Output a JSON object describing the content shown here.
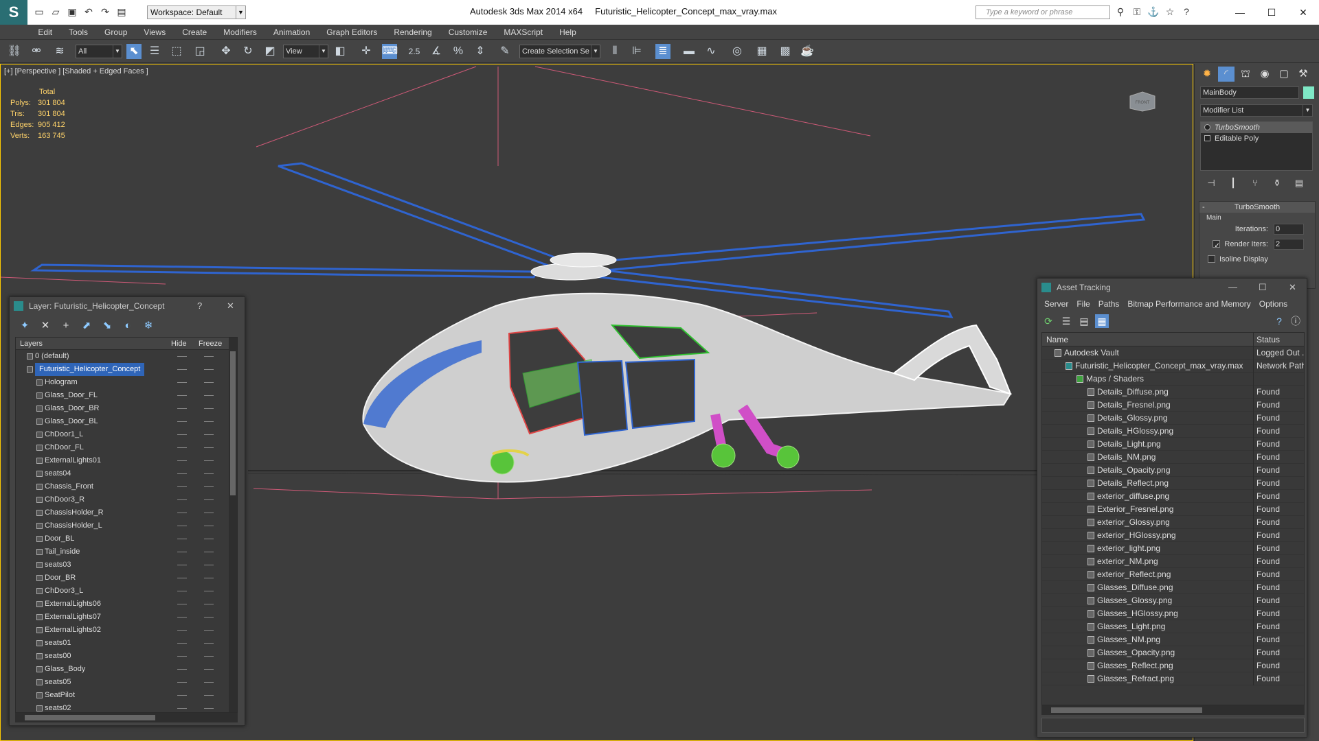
{
  "titlebar": {
    "workspace": "Workspace: Default",
    "app_name": "Autodesk 3ds Max  2014 x64",
    "file_name": "Futuristic_Helicopter_Concept_max_vray.max",
    "search_placeholder": "Type a keyword or phrase",
    "minimize": "—",
    "maximize": "☐",
    "close": "✕"
  },
  "menu": [
    "Edit",
    "Tools",
    "Group",
    "Views",
    "Create",
    "Modifiers",
    "Animation",
    "Graph Editors",
    "Rendering",
    "Customize",
    "MAXScript",
    "Help"
  ],
  "toolbar": {
    "selection_filter": "All",
    "coord_system": "View",
    "snap_label": "2.5",
    "named_selection": "Create Selection Se"
  },
  "viewport": {
    "label": "[+] [Perspective ] [Shaded + Edged Faces ]",
    "stats_header": "Total",
    "stats": [
      {
        "label": "Polys:",
        "value": "301 804"
      },
      {
        "label": "Tris:",
        "value": "301 804"
      },
      {
        "label": "Edges:",
        "value": "905 412"
      },
      {
        "label": "Verts:",
        "value": "163 745"
      }
    ],
    "viewcube_label": "FRONT"
  },
  "command_panel": {
    "object_name": "MainBody",
    "object_color": "#7fe8c6",
    "modifier_list": "Modifier List",
    "stack": [
      {
        "label": "TurboSmooth",
        "selected": true
      },
      {
        "label": "Editable Poly",
        "selected": false
      }
    ],
    "rollout": {
      "title": "TurboSmooth",
      "minus": "-",
      "group": "Main",
      "iterations_label": "Iterations:",
      "iterations_value": "0",
      "render_iters_label": "Render Iters:",
      "render_iters_value": "2",
      "isoline_label": "Isoline Display"
    }
  },
  "layer_dialog": {
    "title": "Layer: Futuristic_Helicopter_Concept",
    "help": "?",
    "close": "✕",
    "columns": {
      "layers": "Layers",
      "hide": "Hide",
      "freeze": "Freeze"
    },
    "rows": [
      {
        "name": "0 (default)",
        "level": 0
      },
      {
        "name": "Futuristic_Helicopter_Concept",
        "level": 0,
        "selected": true
      },
      {
        "name": "Hologram",
        "level": 1
      },
      {
        "name": "Glass_Door_FL",
        "level": 1
      },
      {
        "name": "Glass_Door_BR",
        "level": 1
      },
      {
        "name": "Glass_Door_BL",
        "level": 1
      },
      {
        "name": "ChDoor1_L",
        "level": 1
      },
      {
        "name": "ChDoor_FL",
        "level": 1
      },
      {
        "name": "ExternalLights01",
        "level": 1
      },
      {
        "name": "seats04",
        "level": 1
      },
      {
        "name": "Chassis_Front",
        "level": 1
      },
      {
        "name": "ChDoor3_R",
        "level": 1
      },
      {
        "name": "ChassisHolder_R",
        "level": 1
      },
      {
        "name": "ChassisHolder_L",
        "level": 1
      },
      {
        "name": "Door_BL",
        "level": 1
      },
      {
        "name": "Tail_inside",
        "level": 1
      },
      {
        "name": "seats03",
        "level": 1
      },
      {
        "name": "Door_BR",
        "level": 1
      },
      {
        "name": "ChDoor3_L",
        "level": 1
      },
      {
        "name": "ExternalLights06",
        "level": 1
      },
      {
        "name": "ExternalLights07",
        "level": 1
      },
      {
        "name": "ExternalLights02",
        "level": 1
      },
      {
        "name": "seats01",
        "level": 1
      },
      {
        "name": "seats00",
        "level": 1
      },
      {
        "name": "Glass_Body",
        "level": 1
      },
      {
        "name": "seats05",
        "level": 1
      },
      {
        "name": "SeatPilot",
        "level": 1
      },
      {
        "name": "seats02",
        "level": 1
      }
    ]
  },
  "asset_dialog": {
    "title": "Asset Tracking",
    "menu": [
      "Server",
      "File",
      "Paths",
      "Bitmap Performance and Memory",
      "Options"
    ],
    "columns": {
      "name": "Name",
      "status": "Status"
    },
    "rows": [
      {
        "name": "Autodesk Vault",
        "status": "Logged Out ...",
        "level": 0
      },
      {
        "name": "Futuristic_Helicopter_Concept_max_vray.max",
        "status": "Network Path",
        "level": 1
      },
      {
        "name": "Maps / Shaders",
        "status": "",
        "level": 2
      },
      {
        "name": "Details_Diffuse.png",
        "status": "Found",
        "level": 3
      },
      {
        "name": "Details_Fresnel.png",
        "status": "Found",
        "level": 3
      },
      {
        "name": "Details_Glossy.png",
        "status": "Found",
        "level": 3
      },
      {
        "name": "Details_HGlossy.png",
        "status": "Found",
        "level": 3
      },
      {
        "name": "Details_Light.png",
        "status": "Found",
        "level": 3
      },
      {
        "name": "Details_NM.png",
        "status": "Found",
        "level": 3
      },
      {
        "name": "Details_Opacity.png",
        "status": "Found",
        "level": 3
      },
      {
        "name": "Details_Reflect.png",
        "status": "Found",
        "level": 3
      },
      {
        "name": "exterior_diffuse.png",
        "status": "Found",
        "level": 3
      },
      {
        "name": "Exterior_Fresnel.png",
        "status": "Found",
        "level": 3
      },
      {
        "name": "exterior_Glossy.png",
        "status": "Found",
        "level": 3
      },
      {
        "name": "exterior_HGlossy.png",
        "status": "Found",
        "level": 3
      },
      {
        "name": "exterior_light.png",
        "status": "Found",
        "level": 3
      },
      {
        "name": "exterior_NM.png",
        "status": "Found",
        "level": 3
      },
      {
        "name": "exterior_Reflect.png",
        "status": "Found",
        "level": 3
      },
      {
        "name": "Glasses_Diffuse.png",
        "status": "Found",
        "level": 3
      },
      {
        "name": "Glasses_Glossy.png",
        "status": "Found",
        "level": 3
      },
      {
        "name": "Glasses_HGlossy.png",
        "status": "Found",
        "level": 3
      },
      {
        "name": "Glasses_Light.png",
        "status": "Found",
        "level": 3
      },
      {
        "name": "Glasses_NM.png",
        "status": "Found",
        "level": 3
      },
      {
        "name": "Glasses_Opacity.png",
        "status": "Found",
        "level": 3
      },
      {
        "name": "Glasses_Reflect.png",
        "status": "Found",
        "level": 3
      },
      {
        "name": "Glasses_Refract.png",
        "status": "Found",
        "level": 3
      }
    ]
  }
}
